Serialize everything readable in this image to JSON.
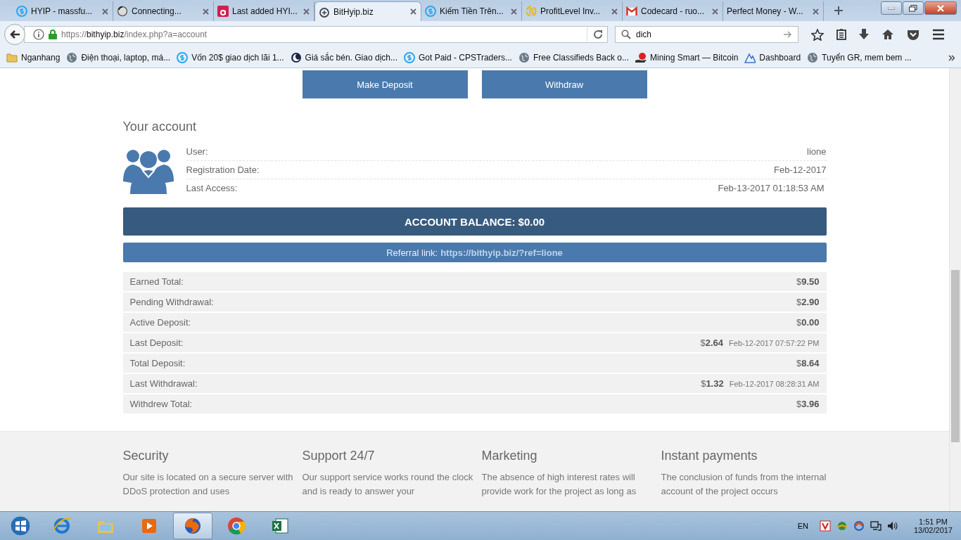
{
  "browser": {
    "tabs": [
      {
        "title": "HYIP - massfu...",
        "selected": false
      },
      {
        "title": "Connecting...",
        "selected": false
      },
      {
        "title": "Last added HYI...",
        "selected": false
      },
      {
        "title": "BitHyip.biz",
        "selected": true
      },
      {
        "title": "Kiếm Tiền Trên...",
        "selected": false
      },
      {
        "title": "ProfitLevel Inv...",
        "selected": false
      },
      {
        "title": "Codecard - ruo...",
        "selected": false
      },
      {
        "title": "Perfect Money - W...",
        "selected": false
      }
    ],
    "url": "https://**bithyip.biz**/index.php?a=account",
    "search": {
      "value": "dich"
    },
    "bookmarks": [
      "Nganhang",
      "Điện thoại, laptop, má...",
      "Vốn 20$ giao dịch lãi 1...",
      "Giá sắc bén. Giao dịch...",
      "Got Paid - CPSTraders...",
      "Free Classifieds Back o...",
      "Mining Smart — Bitcoin",
      "Dashboard",
      "Tuyển GR, mem bem ..."
    ]
  },
  "page": {
    "buttons": [
      "Make Deposit",
      "Withdraw"
    ],
    "heading": "Your account",
    "account": [
      {
        "label": "User:",
        "value": "lione"
      },
      {
        "label": "Registration Date:",
        "value": "Feb-12-2017"
      },
      {
        "label": "Last Access:",
        "value": "Feb-13-2017 01:18:53 AM"
      }
    ],
    "balance": "ACCOUNT BALANCE: $0.00",
    "referral": {
      "label": "Referral link:",
      "link": "https://bithyip.biz/?ref=lione"
    },
    "stats": [
      {
        "label": "Earned Total:",
        "amount": "$**9.50**"
      },
      {
        "label": "Pending Withdrawal:",
        "amount": "$**2.90**"
      },
      {
        "label": "Active Deposit:",
        "amount": "$**0.00**"
      },
      {
        "label": "Last Deposit:",
        "amount": "$**2.64**",
        "date": "Feb-12-2017 07:57:22 PM"
      },
      {
        "label": "Total Deposit:",
        "amount": "$**8.64**"
      },
      {
        "label": "Last Withdrawal:",
        "amount": "$**1.32**",
        "date": "Feb-12-2017 08:28:31 AM"
      },
      {
        "label": "Withdrew Total:",
        "amount": "$**3.96**"
      }
    ],
    "features": [
      {
        "title": "Security",
        "text": "Our site is located on a secure server with DDoS protection and uses"
      },
      {
        "title": "Support 24/7",
        "text": "Our support service works round the clock and is ready to answer your"
      },
      {
        "title": "Marketing",
        "text": "The absence of high interest rates will provide work for the project as long as"
      },
      {
        "title": "Instant payments",
        "text": "The conclusion of funds from the internal account of the project occurs"
      }
    ]
  },
  "taskbar": {
    "language": "EN",
    "time": "1:51 PM",
    "date": "13/02/2017"
  }
}
